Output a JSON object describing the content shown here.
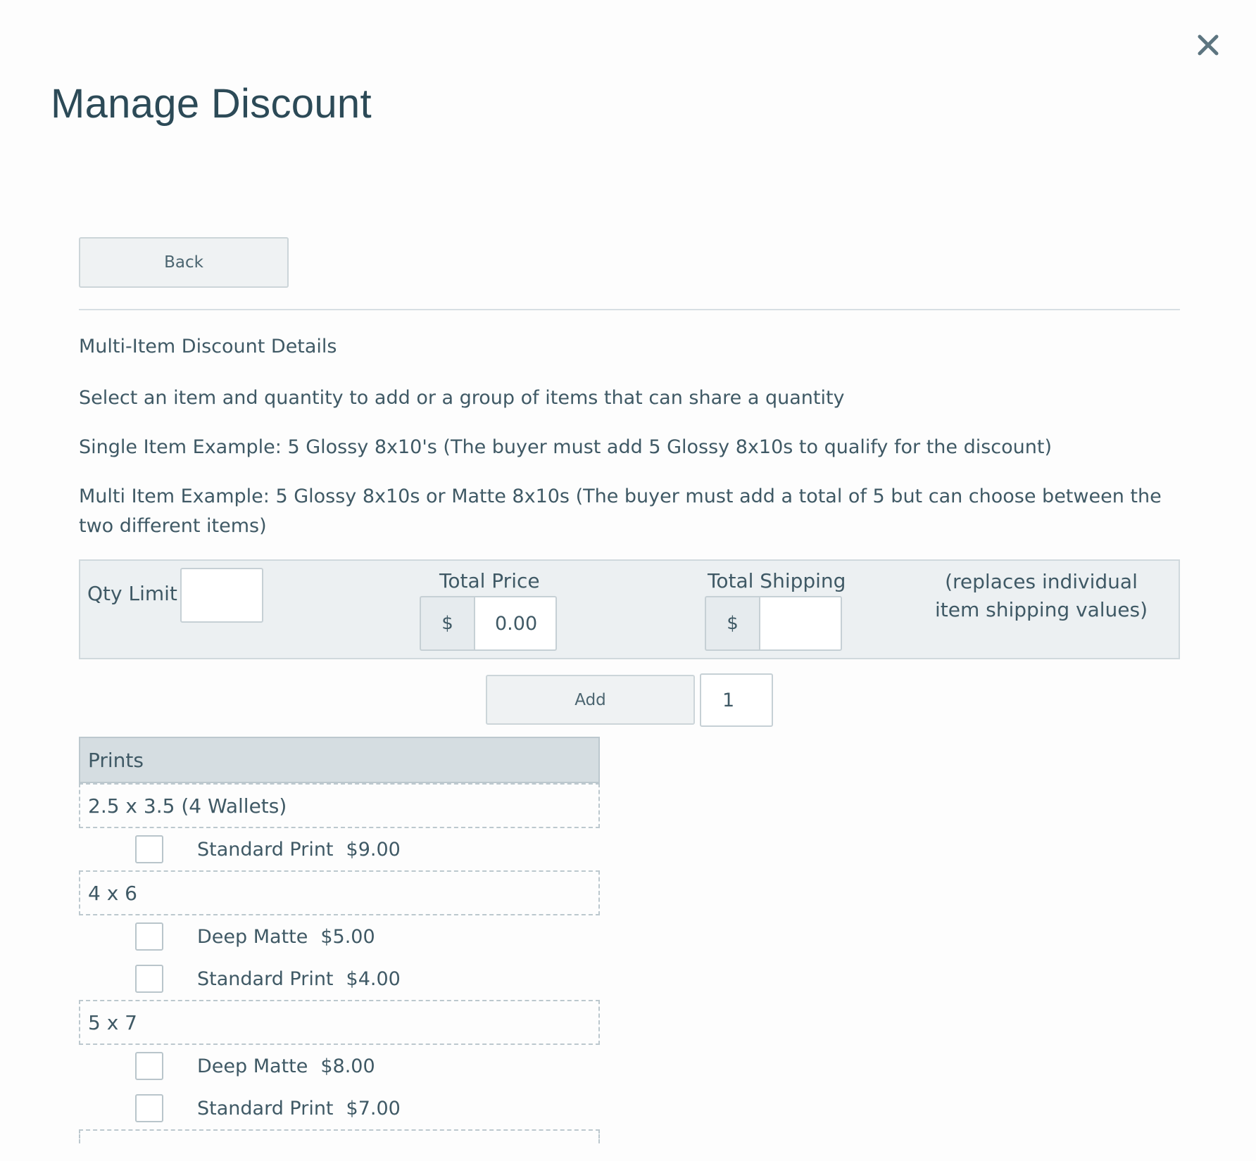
{
  "modal": {
    "title": "Manage Discount",
    "close_icon": "close-icon"
  },
  "toolbar": {
    "back_label": "Back"
  },
  "details": {
    "heading": "Multi-Item Discount Details",
    "instruction": "Select an item and quantity to add or a group of items that can share a quantity",
    "single_example": "Single Item Example: 5 Glossy 8x10's (The buyer must add 5 Glossy 8x10s to qualify for the discount)",
    "multi_example": "Multi Item Example: 5 Glossy 8x10s or Matte 8x10s (The buyer must add a total of 5 but can choose between the two different items)"
  },
  "limits": {
    "qty_limit_label": "Qty Limit",
    "qty_limit_value": "",
    "total_price_label": "Total Price",
    "total_price_prefix": "$",
    "total_price_value": "0.00",
    "total_shipping_label": "Total Shipping",
    "total_shipping_prefix": "$",
    "total_shipping_value": "",
    "shipping_note": "(replaces individual item shipping values)"
  },
  "add": {
    "button_label": "Add",
    "quantity_value": "1"
  },
  "catalog": {
    "header": "Prints",
    "groups": [
      {
        "name": "2.5 x 3.5 (4 Wallets)",
        "items": [
          {
            "label": "Standard Print",
            "price": "$9.00",
            "checked": false
          }
        ]
      },
      {
        "name": "4 x 6",
        "items": [
          {
            "label": "Deep Matte",
            "price": "$5.00",
            "checked": false
          },
          {
            "label": "Standard Print",
            "price": "$4.00",
            "checked": false
          }
        ]
      },
      {
        "name": "5 x 7",
        "items": [
          {
            "label": "Deep Matte",
            "price": "$8.00",
            "checked": false
          },
          {
            "label": "Standard Print",
            "price": "$7.00",
            "checked": false
          }
        ]
      }
    ]
  }
}
